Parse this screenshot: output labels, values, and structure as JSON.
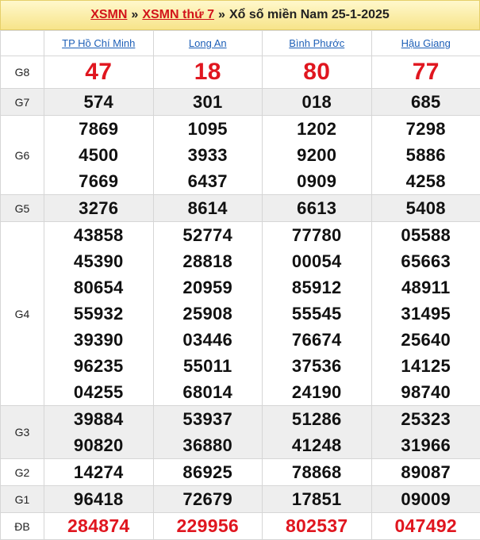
{
  "header": {
    "link1": "XSMN",
    "sep1": "»",
    "link2": "XSMN thứ 7",
    "sep2": "»",
    "title": "Xổ số miền Nam 25-1-2025"
  },
  "provinces": [
    "TP Hồ Chí Minh",
    "Long An",
    "Bình Phước",
    "Hậu Giang"
  ],
  "prizes": [
    {
      "label": "G8",
      "style": "g8",
      "alt": false,
      "values": [
        [
          "47"
        ],
        [
          "18"
        ],
        [
          "80"
        ],
        [
          "77"
        ]
      ]
    },
    {
      "label": "G7",
      "style": "",
      "alt": true,
      "values": [
        [
          "574"
        ],
        [
          "301"
        ],
        [
          "018"
        ],
        [
          "685"
        ]
      ]
    },
    {
      "label": "G6",
      "style": "",
      "alt": false,
      "values": [
        [
          "7869",
          "4500",
          "7669"
        ],
        [
          "1095",
          "3933",
          "6437"
        ],
        [
          "1202",
          "9200",
          "0909"
        ],
        [
          "7298",
          "5886",
          "4258"
        ]
      ]
    },
    {
      "label": "G5",
      "style": "",
      "alt": true,
      "values": [
        [
          "3276"
        ],
        [
          "8614"
        ],
        [
          "6613"
        ],
        [
          "5408"
        ]
      ]
    },
    {
      "label": "G4",
      "style": "",
      "alt": false,
      "values": [
        [
          "43858",
          "45390",
          "80654",
          "55932",
          "39390",
          "96235",
          "04255"
        ],
        [
          "52774",
          "28818",
          "20959",
          "25908",
          "03446",
          "55011",
          "68014"
        ],
        [
          "77780",
          "00054",
          "85912",
          "55545",
          "76674",
          "37536",
          "24190"
        ],
        [
          "05588",
          "65663",
          "48911",
          "31495",
          "25640",
          "14125",
          "98740"
        ]
      ]
    },
    {
      "label": "G3",
      "style": "",
      "alt": true,
      "values": [
        [
          "39884",
          "90820"
        ],
        [
          "53937",
          "36880"
        ],
        [
          "51286",
          "41248"
        ],
        [
          "25323",
          "31966"
        ]
      ]
    },
    {
      "label": "G2",
      "style": "",
      "alt": false,
      "values": [
        [
          "14274"
        ],
        [
          "86925"
        ],
        [
          "78868"
        ],
        [
          "89087"
        ]
      ]
    },
    {
      "label": "G1",
      "style": "",
      "alt": true,
      "values": [
        [
          "96418"
        ],
        [
          "72679"
        ],
        [
          "17851"
        ],
        [
          "09009"
        ]
      ]
    },
    {
      "label": "ĐB",
      "style": "db",
      "alt": false,
      "values": [
        [
          "284874"
        ],
        [
          "229956"
        ],
        [
          "802537"
        ],
        [
          "047492"
        ]
      ]
    }
  ]
}
